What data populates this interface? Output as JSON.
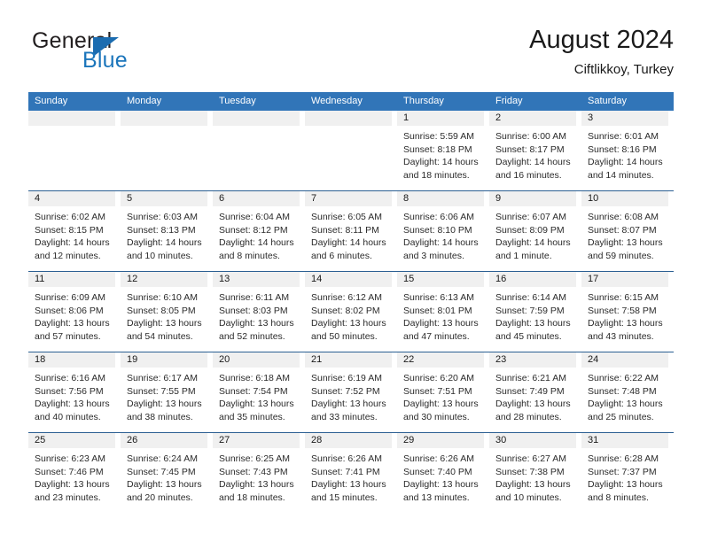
{
  "brand": {
    "name_top": "General",
    "name_bottom": "Blue",
    "accent_color": "#1b75bb",
    "triangle_color": "#1b6cb0",
    "icon": "triangle-logo-icon"
  },
  "header": {
    "title": "August 2024",
    "subtitle": "Ciftlikkoy, Turkey"
  },
  "theme": {
    "header_band": "#3175b8",
    "row_separator": "#2b5f92",
    "date_band": "#f0f0f0",
    "text": "#2b2b2b"
  },
  "weekday_headers": [
    "Sunday",
    "Monday",
    "Tuesday",
    "Wednesday",
    "Thursday",
    "Friday",
    "Saturday"
  ],
  "weeks": [
    [
      {
        "date": "",
        "lines": []
      },
      {
        "date": "",
        "lines": []
      },
      {
        "date": "",
        "lines": []
      },
      {
        "date": "",
        "lines": []
      },
      {
        "date": "1",
        "lines": [
          "Sunrise: 5:59 AM",
          "Sunset: 8:18 PM",
          "Daylight: 14 hours",
          "and 18 minutes."
        ]
      },
      {
        "date": "2",
        "lines": [
          "Sunrise: 6:00 AM",
          "Sunset: 8:17 PM",
          "Daylight: 14 hours",
          "and 16 minutes."
        ]
      },
      {
        "date": "3",
        "lines": [
          "Sunrise: 6:01 AM",
          "Sunset: 8:16 PM",
          "Daylight: 14 hours",
          "and 14 minutes."
        ]
      }
    ],
    [
      {
        "date": "4",
        "lines": [
          "Sunrise: 6:02 AM",
          "Sunset: 8:15 PM",
          "Daylight: 14 hours",
          "and 12 minutes."
        ]
      },
      {
        "date": "5",
        "lines": [
          "Sunrise: 6:03 AM",
          "Sunset: 8:13 PM",
          "Daylight: 14 hours",
          "and 10 minutes."
        ]
      },
      {
        "date": "6",
        "lines": [
          "Sunrise: 6:04 AM",
          "Sunset: 8:12 PM",
          "Daylight: 14 hours",
          "and 8 minutes."
        ]
      },
      {
        "date": "7",
        "lines": [
          "Sunrise: 6:05 AM",
          "Sunset: 8:11 PM",
          "Daylight: 14 hours",
          "and 6 minutes."
        ]
      },
      {
        "date": "8",
        "lines": [
          "Sunrise: 6:06 AM",
          "Sunset: 8:10 PM",
          "Daylight: 14 hours",
          "and 3 minutes."
        ]
      },
      {
        "date": "9",
        "lines": [
          "Sunrise: 6:07 AM",
          "Sunset: 8:09 PM",
          "Daylight: 14 hours",
          "and 1 minute."
        ]
      },
      {
        "date": "10",
        "lines": [
          "Sunrise: 6:08 AM",
          "Sunset: 8:07 PM",
          "Daylight: 13 hours",
          "and 59 minutes."
        ]
      }
    ],
    [
      {
        "date": "11",
        "lines": [
          "Sunrise: 6:09 AM",
          "Sunset: 8:06 PM",
          "Daylight: 13 hours",
          "and 57 minutes."
        ]
      },
      {
        "date": "12",
        "lines": [
          "Sunrise: 6:10 AM",
          "Sunset: 8:05 PM",
          "Daylight: 13 hours",
          "and 54 minutes."
        ]
      },
      {
        "date": "13",
        "lines": [
          "Sunrise: 6:11 AM",
          "Sunset: 8:03 PM",
          "Daylight: 13 hours",
          "and 52 minutes."
        ]
      },
      {
        "date": "14",
        "lines": [
          "Sunrise: 6:12 AM",
          "Sunset: 8:02 PM",
          "Daylight: 13 hours",
          "and 50 minutes."
        ]
      },
      {
        "date": "15",
        "lines": [
          "Sunrise: 6:13 AM",
          "Sunset: 8:01 PM",
          "Daylight: 13 hours",
          "and 47 minutes."
        ]
      },
      {
        "date": "16",
        "lines": [
          "Sunrise: 6:14 AM",
          "Sunset: 7:59 PM",
          "Daylight: 13 hours",
          "and 45 minutes."
        ]
      },
      {
        "date": "17",
        "lines": [
          "Sunrise: 6:15 AM",
          "Sunset: 7:58 PM",
          "Daylight: 13 hours",
          "and 43 minutes."
        ]
      }
    ],
    [
      {
        "date": "18",
        "lines": [
          "Sunrise: 6:16 AM",
          "Sunset: 7:56 PM",
          "Daylight: 13 hours",
          "and 40 minutes."
        ]
      },
      {
        "date": "19",
        "lines": [
          "Sunrise: 6:17 AM",
          "Sunset: 7:55 PM",
          "Daylight: 13 hours",
          "and 38 minutes."
        ]
      },
      {
        "date": "20",
        "lines": [
          "Sunrise: 6:18 AM",
          "Sunset: 7:54 PM",
          "Daylight: 13 hours",
          "and 35 minutes."
        ]
      },
      {
        "date": "21",
        "lines": [
          "Sunrise: 6:19 AM",
          "Sunset: 7:52 PM",
          "Daylight: 13 hours",
          "and 33 minutes."
        ]
      },
      {
        "date": "22",
        "lines": [
          "Sunrise: 6:20 AM",
          "Sunset: 7:51 PM",
          "Daylight: 13 hours",
          "and 30 minutes."
        ]
      },
      {
        "date": "23",
        "lines": [
          "Sunrise: 6:21 AM",
          "Sunset: 7:49 PM",
          "Daylight: 13 hours",
          "and 28 minutes."
        ]
      },
      {
        "date": "24",
        "lines": [
          "Sunrise: 6:22 AM",
          "Sunset: 7:48 PM",
          "Daylight: 13 hours",
          "and 25 minutes."
        ]
      }
    ],
    [
      {
        "date": "25",
        "lines": [
          "Sunrise: 6:23 AM",
          "Sunset: 7:46 PM",
          "Daylight: 13 hours",
          "and 23 minutes."
        ]
      },
      {
        "date": "26",
        "lines": [
          "Sunrise: 6:24 AM",
          "Sunset: 7:45 PM",
          "Daylight: 13 hours",
          "and 20 minutes."
        ]
      },
      {
        "date": "27",
        "lines": [
          "Sunrise: 6:25 AM",
          "Sunset: 7:43 PM",
          "Daylight: 13 hours",
          "and 18 minutes."
        ]
      },
      {
        "date": "28",
        "lines": [
          "Sunrise: 6:26 AM",
          "Sunset: 7:41 PM",
          "Daylight: 13 hours",
          "and 15 minutes."
        ]
      },
      {
        "date": "29",
        "lines": [
          "Sunrise: 6:26 AM",
          "Sunset: 7:40 PM",
          "Daylight: 13 hours",
          "and 13 minutes."
        ]
      },
      {
        "date": "30",
        "lines": [
          "Sunrise: 6:27 AM",
          "Sunset: 7:38 PM",
          "Daylight: 13 hours",
          "and 10 minutes."
        ]
      },
      {
        "date": "31",
        "lines": [
          "Sunrise: 6:28 AM",
          "Sunset: 7:37 PM",
          "Daylight: 13 hours",
          "and 8 minutes."
        ]
      }
    ]
  ]
}
